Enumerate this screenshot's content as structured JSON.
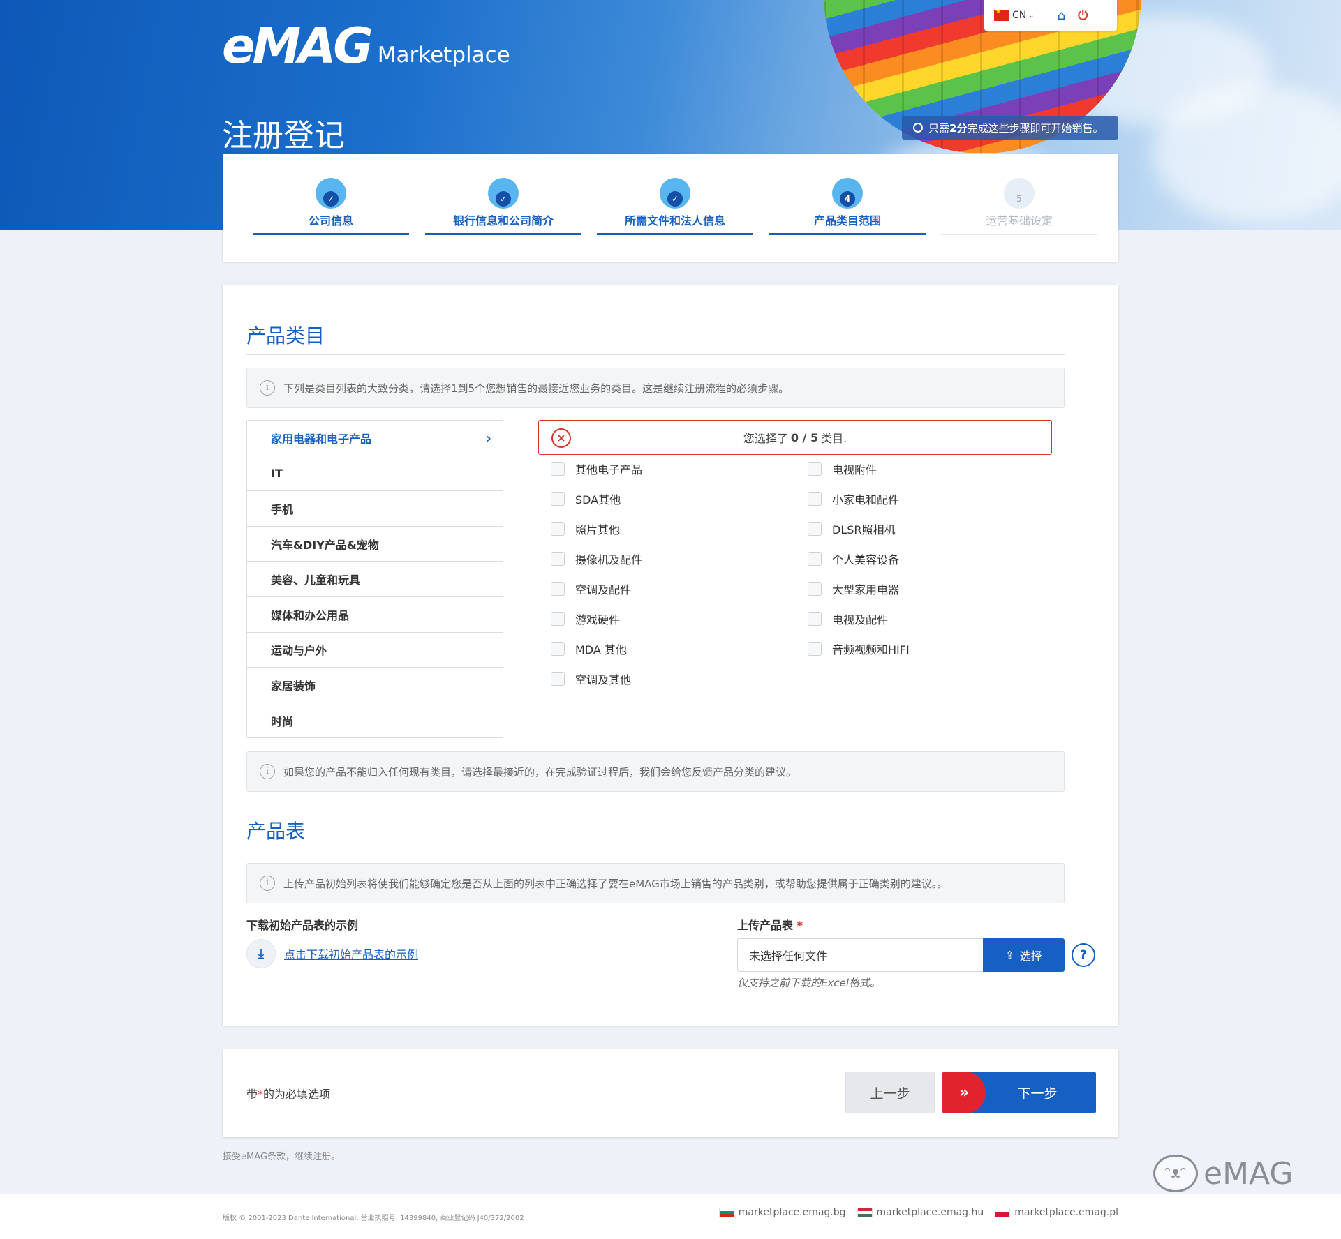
{
  "header": {
    "logo_main": "eMAG",
    "logo_sub": "Marketplace",
    "page_title": "注册登记",
    "time_badge_pre": "只需",
    "time_badge_bold": "2分",
    "time_badge_post": "完成这些步骤即可开始销售。",
    "lang": "CN"
  },
  "steps": [
    {
      "num": "",
      "label": "公司信息"
    },
    {
      "num": "",
      "label": "银行信息和公司简介"
    },
    {
      "num": "",
      "label": "所需文件和法人信息"
    },
    {
      "num": "4",
      "label": "产品类目范围"
    },
    {
      "num": "5",
      "label": "运营基础设定"
    }
  ],
  "categories": {
    "section_title": "产品类目",
    "notice": "下列是类目列表的大致分类，请选择1到5个您想销售的最接近您业务的类目。这是继续注册流程的必须步骤。",
    "list": [
      "家用电器和电子产品",
      "IT",
      "手机",
      "汽车&DIY产品&宠物",
      "美容、儿童和玩具",
      "媒体和办公用品",
      "运动与户外",
      "家居装饰",
      "时尚"
    ],
    "alert_pre": "您选择了",
    "alert_count": "0 / 5",
    "alert_post": "类目.",
    "subs_left": [
      "其他电子产品",
      "SDA其他",
      "照片其他",
      "摄像机及配件",
      "空调及配件",
      "游戏硬件",
      "MDA 其他",
      "空调及其他"
    ],
    "subs_right": [
      "电视附件",
      "小家电和配件",
      "DLSR照相机",
      "个人美容设备",
      "大型家用电器",
      "电视及配件",
      "音频视频和HIFI"
    ],
    "bottom_notice": "如果您的产品不能归入任何现有类目，请选择最接近的，在完成验证过程后，我们会给您反馈产品分类的建议。"
  },
  "product_sheet": {
    "section_title": "产品表",
    "notice": "上传产品初始列表将使我们能够确定您是否从上面的列表中正确选择了要在eMAG市场上销售的产品类别，或帮助您提供属于正确类别的建议。。",
    "download_label": "下载初始产品表的示例",
    "download_link": "点击下载初始产品表的示例",
    "upload_label": "上传产品表",
    "upload_required": "*",
    "file_placeholder": "未选择任何文件",
    "choose_button": "选择",
    "hint": "仅支持之前下载的Excel格式。"
  },
  "bottom": {
    "req_pre": "带",
    "req_star": "*",
    "req_post": "的为必填选项",
    "prev": "上一步",
    "next": "下一步"
  },
  "terms": "接受eMAG条款，继续注册。",
  "footer": {
    "copyright": "版权 © 2001-2023 Dante International, 营业执照号: 14399840, 商业登记码 J40/372/2002",
    "sites": [
      "marketplace.emag.bg",
      "marketplace.emag.hu",
      "marketplace.emag.pl"
    ]
  },
  "watermark": "eMAG",
  "colors": {
    "brand_blue": "#1660c4",
    "accent_red": "#e1232e"
  }
}
